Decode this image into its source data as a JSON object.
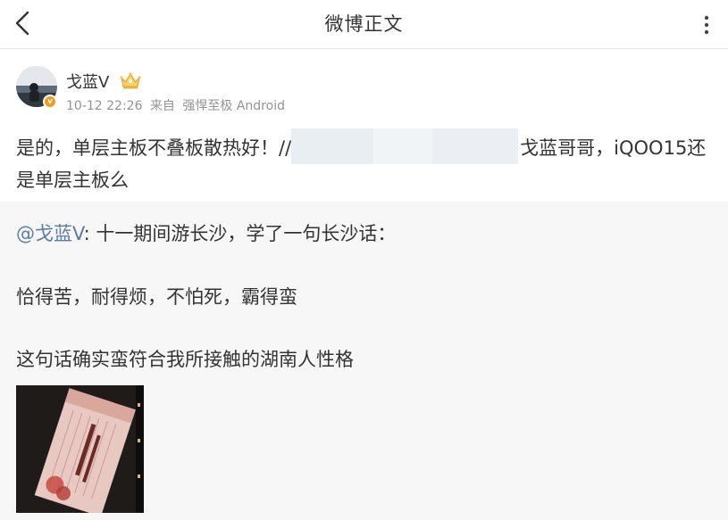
{
  "header": {
    "title": "微博正文",
    "back_icon": "chevron-left-icon",
    "more_icon": "more-dots-icon"
  },
  "post": {
    "author": "戈蓝V",
    "badge_icon": "crown-icon",
    "verified_mark": "v",
    "time": "10-12 22:26",
    "source_prefix": "来自",
    "source": "强悍至极 Android",
    "text_part1": "是的，单层主板不叠板散热好！//",
    "text_part2": "戈蓝哥哥，iQOO15还是单层主板么"
  },
  "repost": {
    "mention": "@戈蓝V",
    "line1_text": ": 十一期间游长沙，学了一句长沙话：",
    "line2": "恰得苦，耐得烦，不怕死，霸得蛮",
    "line3": "这句话确实蛮符合我所接触的湖南人性格"
  },
  "colors": {
    "link": "#5b7ca7",
    "meta": "#939393",
    "repost_bg": "#f7f7f7",
    "badge": "#f29a1a"
  }
}
